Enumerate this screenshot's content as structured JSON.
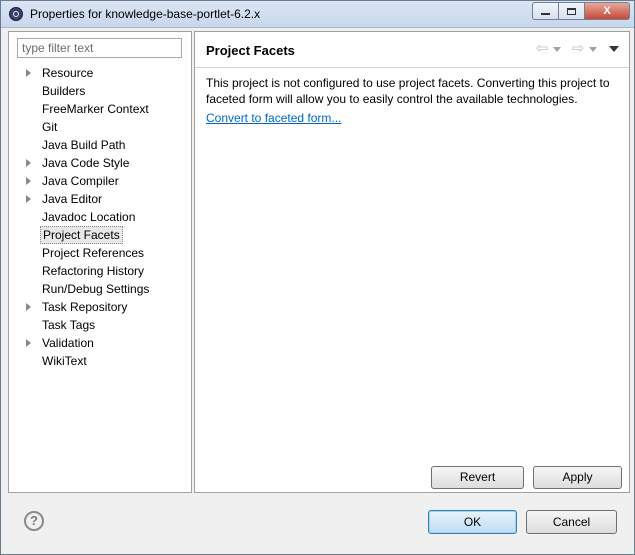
{
  "window": {
    "title": "Properties for knowledge-base-portlet-6.2.x",
    "controls": {
      "minimize": "minimize",
      "maximize": "maximize",
      "close": "X"
    }
  },
  "filter": {
    "placeholder": "type filter text",
    "value": ""
  },
  "tree": {
    "items": [
      {
        "label": "Resource",
        "expandable": true
      },
      {
        "label": "Builders",
        "expandable": false
      },
      {
        "label": "FreeMarker Context",
        "expandable": false
      },
      {
        "label": "Git",
        "expandable": false
      },
      {
        "label": "Java Build Path",
        "expandable": false
      },
      {
        "label": "Java Code Style",
        "expandable": true
      },
      {
        "label": "Java Compiler",
        "expandable": true
      },
      {
        "label": "Java Editor",
        "expandable": true
      },
      {
        "label": "Javadoc Location",
        "expandable": false
      },
      {
        "label": "Project Facets",
        "expandable": false,
        "selected": true
      },
      {
        "label": "Project References",
        "expandable": false
      },
      {
        "label": "Refactoring History",
        "expandable": false
      },
      {
        "label": "Run/Debug Settings",
        "expandable": false
      },
      {
        "label": "Task Repository",
        "expandable": true
      },
      {
        "label": "Task Tags",
        "expandable": false
      },
      {
        "label": "Validation",
        "expandable": true
      },
      {
        "label": "WikiText",
        "expandable": false
      }
    ]
  },
  "page": {
    "title": "Project Facets",
    "description": "This project is not configured to use project facets. Converting this project to faceted form will allow you to easily control the available technologies.",
    "link": "Convert to faceted form..."
  },
  "buttons": {
    "revert": "Revert",
    "apply": "Apply",
    "ok": "OK",
    "cancel": "Cancel",
    "help": "?"
  },
  "icons": {
    "back": "back-arrow-icon",
    "forward": "forward-arrow-icon",
    "menu": "view-menu-icon",
    "help": "help-icon"
  },
  "colors": {
    "link": "#0066cc",
    "default_button": "#bfdcf5"
  }
}
